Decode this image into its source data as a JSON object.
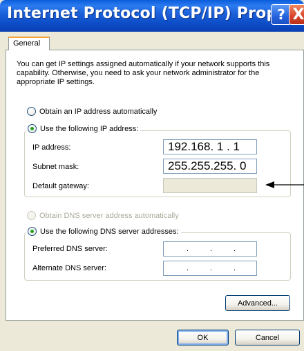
{
  "window": {
    "title": "Internet Protocol (TCP/IP) Properties",
    "help_label": "?",
    "close_label": "X"
  },
  "tabs": [
    {
      "label": "General"
    }
  ],
  "intro_text": "You can get IP settings assigned automatically if your network supports this capability. Otherwise, you need to ask your network administrator for the appropriate IP settings.",
  "ip_section": {
    "obtain_auto_label": "Obtain an IP address automatically",
    "use_following_label": "Use the following IP address:",
    "selected": "use_following",
    "fields": [
      {
        "label": "IP address:",
        "value": "192.168. 1 . 1"
      },
      {
        "label": "Subnet mask:",
        "value": "255.255.255. 0"
      },
      {
        "label": "Default gateway:",
        "value": ""
      }
    ]
  },
  "dns_section": {
    "obtain_auto_label": "Obtain DNS server address automatically",
    "obtain_auto_enabled": false,
    "use_following_label": "Use the following DNS server addresses:",
    "selected": "use_following",
    "fields": [
      {
        "label": "Preferred DNS server:",
        "value": ""
      },
      {
        "label": "Alternate DNS server:",
        "value": ""
      }
    ]
  },
  "buttons": {
    "advanced": "Advanced...",
    "ok": "OK",
    "cancel": "Cancel"
  },
  "ip_dot_separator": ".",
  "colors": {
    "title_bar": "#0A5DDB",
    "dialog_bg": "#ECE9D8",
    "radio_selected": "#21A121",
    "tab_highlight": "#F4A23A"
  }
}
